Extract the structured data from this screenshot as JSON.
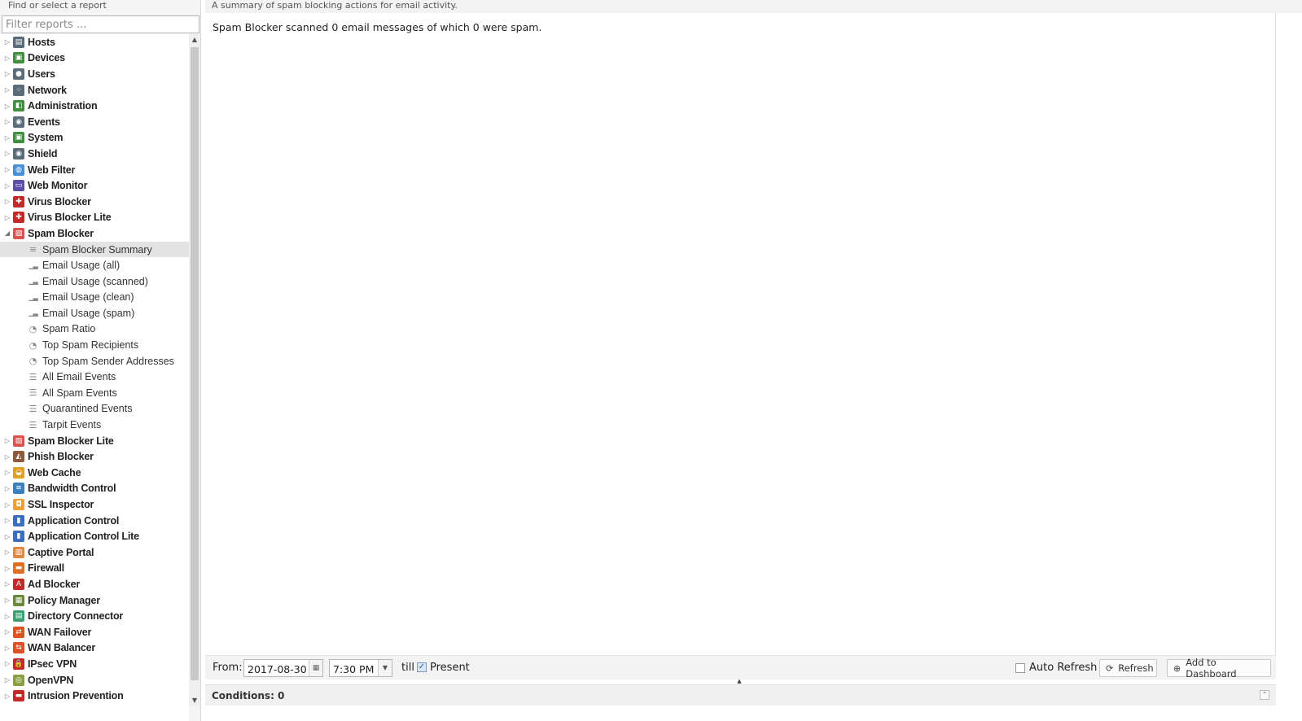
{
  "sidebar": {
    "title": "Find or select a report",
    "filter_placeholder": "Filter reports ..."
  },
  "tree": {
    "top_items": [
      {
        "label": "Hosts",
        "icon": "hosts-icon",
        "color": "#5a6b7a"
      },
      {
        "label": "Devices",
        "icon": "devices-icon",
        "color": "#3f8f3f"
      },
      {
        "label": "Users",
        "icon": "users-icon",
        "color": "#5a6b7a"
      },
      {
        "label": "Network",
        "icon": "network-icon",
        "color": "#5a6b7a"
      },
      {
        "label": "Administration",
        "icon": "administration-icon",
        "color": "#3f8f3f"
      },
      {
        "label": "Events",
        "icon": "events-icon",
        "color": "#5a6b7a"
      },
      {
        "label": "System",
        "icon": "system-icon",
        "color": "#3f8f3f"
      },
      {
        "label": "Shield",
        "icon": "shield-icon",
        "color": "#5a6b7a"
      }
    ],
    "items": [
      {
        "label": "Web Filter",
        "icon": "web-filter-icon",
        "color": "#4a90d9"
      },
      {
        "label": "Web Monitor",
        "icon": "web-monitor-icon",
        "color": "#5b4fa8"
      },
      {
        "label": "Virus Blocker",
        "icon": "virus-blocker-icon",
        "color": "#c62828"
      },
      {
        "label": "Virus Blocker Lite",
        "icon": "virus-blocker-lite-icon",
        "color": "#c62828"
      }
    ],
    "spam_blocker": {
      "label": "Spam Blocker",
      "icon": "spam-blocker-icon",
      "color": "#d9534f",
      "children": [
        {
          "label": "Spam Blocker Summary",
          "icon": "text-icon",
          "selected": true
        },
        {
          "label": "Email Usage (all)",
          "icon": "bar-chart-icon"
        },
        {
          "label": "Email Usage (scanned)",
          "icon": "bar-chart-icon"
        },
        {
          "label": "Email Usage (clean)",
          "icon": "bar-chart-icon"
        },
        {
          "label": "Email Usage (spam)",
          "icon": "bar-chart-icon"
        },
        {
          "label": "Spam Ratio",
          "icon": "pie-chart-icon"
        },
        {
          "label": "Top Spam Recipients",
          "icon": "pie-chart-icon"
        },
        {
          "label": "Top Spam Sender Addresses",
          "icon": "pie-chart-icon"
        },
        {
          "label": "All Email Events",
          "icon": "list-icon"
        },
        {
          "label": "All Spam Events",
          "icon": "list-icon"
        },
        {
          "label": "Quarantined Events",
          "icon": "list-icon"
        },
        {
          "label": "Tarpit Events",
          "icon": "list-icon"
        }
      ]
    },
    "bottom_items": [
      {
        "label": "Spam Blocker Lite",
        "icon": "spam-blocker-lite-icon",
        "color": "#d9534f"
      },
      {
        "label": "Phish Blocker",
        "icon": "phish-blocker-icon",
        "color": "#8e5a3c"
      },
      {
        "label": "Web Cache",
        "icon": "web-cache-icon",
        "color": "#e0a020"
      },
      {
        "label": "Bandwidth Control",
        "icon": "bandwidth-control-icon",
        "color": "#3a7fc0"
      },
      {
        "label": "SSL Inspector",
        "icon": "ssl-inspector-icon",
        "color": "#f0a030"
      },
      {
        "label": "Application Control",
        "icon": "application-control-icon",
        "color": "#3a6fc0"
      },
      {
        "label": "Application Control Lite",
        "icon": "application-control-lite-icon",
        "color": "#3a6fc0"
      },
      {
        "label": "Captive Portal",
        "icon": "captive-portal-icon",
        "color": "#e08a40"
      },
      {
        "label": "Firewall",
        "icon": "firewall-icon",
        "color": "#e07020"
      },
      {
        "label": "Ad Blocker",
        "icon": "ad-blocker-icon",
        "color": "#c62828"
      },
      {
        "label": "Policy Manager",
        "icon": "policy-manager-icon",
        "color": "#6a8a3a"
      },
      {
        "label": "Directory Connector",
        "icon": "directory-connector-icon",
        "color": "#3aa070"
      },
      {
        "label": "WAN Failover",
        "icon": "wan-failover-icon",
        "color": "#e05020"
      },
      {
        "label": "WAN Balancer",
        "icon": "wan-balancer-icon",
        "color": "#e05020"
      },
      {
        "label": "IPsec VPN",
        "icon": "ipsec-vpn-icon",
        "color": "#c62828"
      },
      {
        "label": "OpenVPN",
        "icon": "openvpn-icon",
        "color": "#8aa040"
      },
      {
        "label": "Intrusion Prevention",
        "icon": "intrusion-prevention-icon",
        "color": "#c62828"
      }
    ]
  },
  "main": {
    "description": "A summary of spam blocking actions for email activity.",
    "summary": "Spam Blocker scanned 0 email messages of which 0 were spam."
  },
  "toolbar": {
    "from_label": "From:",
    "date_value": "2017-08-30",
    "time_value": "7:30 PM",
    "till_label": "till",
    "present_label": "Present",
    "present_checked": true,
    "auto_refresh_label": "Auto Refresh",
    "refresh_label": "Refresh",
    "add_dashboard_label": "Add to Dashboard"
  },
  "conditions": {
    "label": "Conditions: 0"
  }
}
